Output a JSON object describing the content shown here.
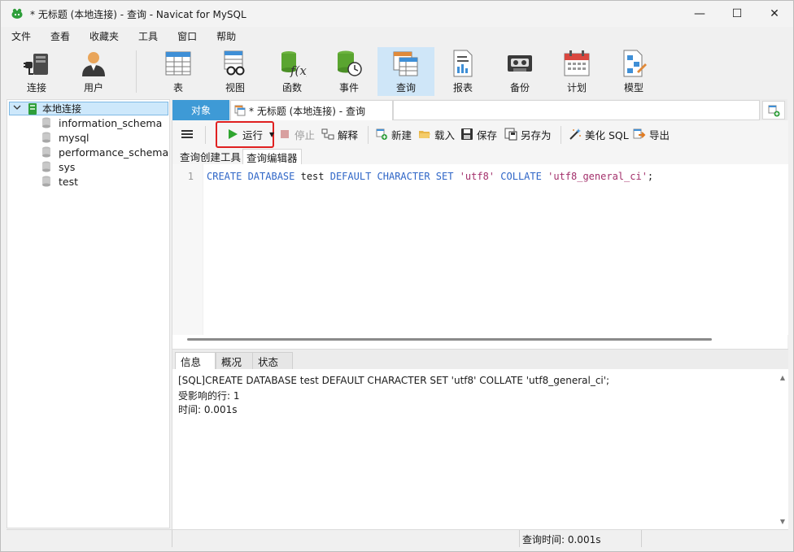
{
  "window": {
    "title": "* 无标题 (本地连接) - 查询 - Navicat for MySQL",
    "controls": {
      "minimize": "—",
      "maximize": "☐",
      "close": "✕"
    }
  },
  "menu": [
    "文件",
    "查看",
    "收藏夹",
    "工具",
    "窗口",
    "帮助"
  ],
  "toolbar": {
    "items": [
      {
        "label": "连接",
        "icon": "plug-icon"
      },
      {
        "label": "用户",
        "icon": "user-icon"
      },
      {
        "label": "表",
        "icon": "table-icon"
      },
      {
        "label": "视图",
        "icon": "view-icon"
      },
      {
        "label": "函数",
        "icon": "function-icon"
      },
      {
        "label": "事件",
        "icon": "event-icon"
      },
      {
        "label": "查询",
        "icon": "query-icon",
        "active": true
      },
      {
        "label": "报表",
        "icon": "report-icon"
      },
      {
        "label": "备份",
        "icon": "backup-icon"
      },
      {
        "label": "计划",
        "icon": "schedule-icon"
      },
      {
        "label": "模型",
        "icon": "model-icon"
      }
    ]
  },
  "tree": {
    "connection": "本地连接",
    "databases": [
      "information_schema",
      "mysql",
      "performance_schema",
      "sys",
      "test"
    ]
  },
  "tabs": {
    "objects": "对象",
    "query": "* 无标题 (本地连接) - 查询"
  },
  "query_toolbar": {
    "run": "运行",
    "stop": "停止",
    "explain": "解释",
    "new": "新建",
    "load": "载入",
    "save": "保存",
    "save_as": "另存为",
    "beautify": "美化 SQL",
    "export": "导出"
  },
  "subtabs": {
    "builder": "查询创建工具",
    "editor": "查询编辑器"
  },
  "editor": {
    "line_number": "1",
    "tokens": {
      "t1": "CREATE DATABASE",
      "t2": " test ",
      "t3": "DEFAULT CHARACTER SET",
      "t4": " ",
      "t5": "'utf8'",
      "t6": " ",
      "t7": "COLLATE",
      "t8": " ",
      "t9": "'utf8_general_ci'",
      "t10": ";"
    }
  },
  "result_tabs": [
    "信息",
    "概况",
    "状态"
  ],
  "result": {
    "line1": "[SQL]CREATE DATABASE test DEFAULT CHARACTER SET 'utf8' COLLATE 'utf8_general_ci';",
    "line2": "受影响的行: 1",
    "line3": "时间: 0.001s"
  },
  "status": {
    "query_time": "查询时间: 0.001s"
  },
  "colors": {
    "accent": "#3e9ad6",
    "active_toolbar": "#cfe6f8",
    "keyword": "#2f66c7",
    "string": "#a3306b",
    "highlight_box": "#e02020"
  }
}
